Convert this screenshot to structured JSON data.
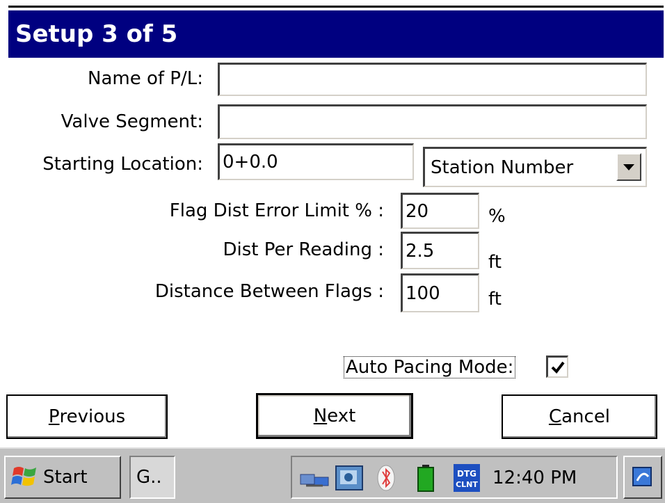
{
  "window": {
    "title": "Setup 3 of 5"
  },
  "form": {
    "pl_name": {
      "label": "Name of P/L:",
      "value": ""
    },
    "valve_segment": {
      "label": "Valve Segment:",
      "value": ""
    },
    "starting_location": {
      "label": "Starting Location:",
      "value": "0+0.0"
    },
    "location_type": {
      "selected": "Station Number"
    },
    "flag_error": {
      "label": "Flag Dist Error Limit % :",
      "value": "20",
      "unit": "%"
    },
    "dist_per_reading": {
      "label": "Dist Per Reading :",
      "value": "2.5",
      "unit": "ft"
    },
    "dist_between_flags": {
      "label": "Distance Between Flags :",
      "value": "100",
      "unit": "ft"
    },
    "auto_pacing": {
      "label": "Auto Pacing Mode:",
      "checked": true
    }
  },
  "buttons": {
    "previous": {
      "pre": "",
      "key": "P",
      "post": "revious"
    },
    "next": {
      "pre": "",
      "key": "N",
      "post": "ext"
    },
    "cancel": {
      "pre": "",
      "key": "C",
      "post": "ancel"
    }
  },
  "taskbar": {
    "start_label": "Start",
    "task_label": "G..",
    "time": "12:40 PM",
    "tray_icons": [
      "network-icon",
      "app-icon",
      "bluetooth-icon",
      "battery-icon",
      "dtg-icon"
    ],
    "tray_dtg_text": "DTG CLNT"
  },
  "colors": {
    "title_bar": "#000080",
    "taskbar": "#c0c0c0"
  }
}
